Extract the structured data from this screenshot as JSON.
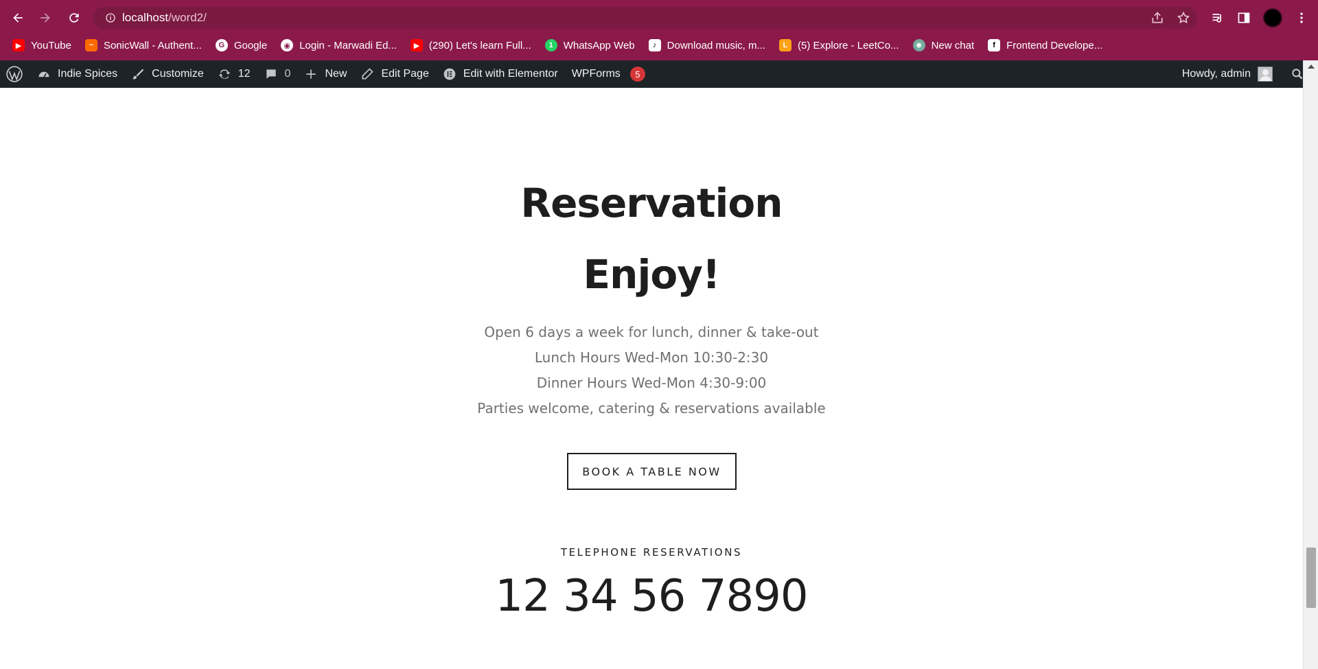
{
  "browser": {
    "url_host": "localhost",
    "url_path": "/word2/",
    "bookmarks": [
      {
        "label": "YouTube",
        "icon": "youtube-icon",
        "color": "#ff0000"
      },
      {
        "label": "SonicWall - Authent...",
        "icon": "sonicwall-icon",
        "color": "#ff6a00"
      },
      {
        "label": "Google",
        "icon": "google-icon",
        "color": "#ffffff"
      },
      {
        "label": "Login - Marwadi Ed...",
        "icon": "globe-icon",
        "color": "#ffffff"
      },
      {
        "label": "(290) Let's learn Full...",
        "icon": "youtube-icon",
        "color": "#ff0000"
      },
      {
        "label": "WhatsApp Web",
        "icon": "whatsapp-icon",
        "color": "#25d366"
      },
      {
        "label": "Download music, m...",
        "icon": "music-icon",
        "color": "#ffffff"
      },
      {
        "label": "(5) Explore - LeetCo...",
        "icon": "leetcode-icon",
        "color": "#ffa116"
      },
      {
        "label": "New chat",
        "icon": "chatgpt-icon",
        "color": "#74aa9c"
      },
      {
        "label": "Frontend Develope...",
        "icon": "frontend-icon",
        "color": "#000000"
      }
    ]
  },
  "adminbar": {
    "site_name": "Indie Spices",
    "customize": "Customize",
    "updates_count": "12",
    "comments_count": "0",
    "new_label": "New",
    "edit_page": "Edit Page",
    "edit_elementor": "Edit with Elementor",
    "wpforms": "WPForms",
    "wpforms_badge": "5",
    "howdy": "Howdy, admin"
  },
  "main": {
    "title": "Reservation",
    "subtitle": "Enjoy!",
    "lines": [
      "Open 6 days a week for lunch, dinner & take-out",
      "Lunch Hours Wed-Mon 10:30-2:30",
      "Dinner Hours Wed-Mon 4:30-9:00",
      "Parties welcome, catering & reservations available"
    ],
    "button": "BOOK A TABLE NOW",
    "tel_label": "TELEPHONE RESERVATIONS",
    "tel_number": "12 34 56 7890"
  },
  "colors": {
    "chrome_bg": "#8b1a4b",
    "adminbar_bg": "#1d2327",
    "heading": "#1e1e1e",
    "body_text": "#707070",
    "badge": "#d63638"
  }
}
